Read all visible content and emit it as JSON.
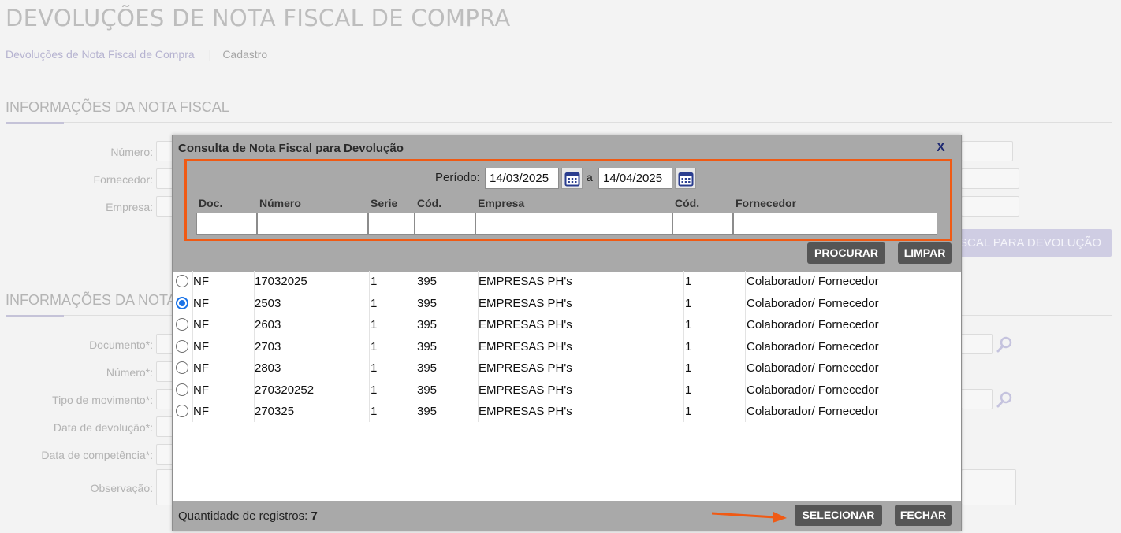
{
  "page": {
    "title": "DEVOLUÇÕES DE NOTA FISCAL DE COMPRA",
    "breadcrumb": [
      "Devoluções de Nota Fiscal de Compra",
      "Cadastro"
    ]
  },
  "section1": {
    "title": "INFORMAÇÕES DA NOTA FISCAL",
    "fields": {
      "numero": "Número:",
      "fornecedor": "Fornecedor:",
      "empresa": "Empresa:"
    },
    "button_partial": "SCAL PARA DEVOLUÇÃO"
  },
  "section2": {
    "title": "INFORMAÇÕES DA NOTA",
    "fields": {
      "documento": "Documento*:",
      "numero": "Número*:",
      "tipo_movimento": "Tipo de movimento*:",
      "data_devolucao": "Data de devolução*:",
      "data_competencia": "Data de competência*:",
      "observacao": "Observação:"
    }
  },
  "modal": {
    "title": "Consulta de Nota Fiscal para Devolução",
    "close_label": "X",
    "period_label": "Período:",
    "date_from": "14/03/2025",
    "date_sep": "a",
    "date_to": "14/04/2025",
    "columns": {
      "doc": "Doc.",
      "numero": "Número",
      "serie": "Serie",
      "cod_empresa": "Cód.",
      "empresa": "Empresa",
      "cod_fornecedor": "Cód.",
      "fornecedor": "Fornecedor"
    },
    "search_button": "PROCURAR",
    "clear_button": "LIMPAR",
    "rows": [
      {
        "doc": "NF",
        "numero": "17032025",
        "serie": "1",
        "cod_empresa": "395",
        "empresa": "EMPRESAS PH's",
        "cod_fornecedor": "1",
        "fornecedor": "Colaborador/ Fornecedor"
      },
      {
        "doc": "NF",
        "numero": "2503",
        "serie": "1",
        "cod_empresa": "395",
        "empresa": "EMPRESAS PH's",
        "cod_fornecedor": "1",
        "fornecedor": "Colaborador/ Fornecedor"
      },
      {
        "doc": "NF",
        "numero": "2603",
        "serie": "1",
        "cod_empresa": "395",
        "empresa": "EMPRESAS PH's",
        "cod_fornecedor": "1",
        "fornecedor": "Colaborador/ Fornecedor"
      },
      {
        "doc": "NF",
        "numero": "2703",
        "serie": "1",
        "cod_empresa": "395",
        "empresa": "EMPRESAS PH's",
        "cod_fornecedor": "1",
        "fornecedor": "Colaborador/ Fornecedor"
      },
      {
        "doc": "NF",
        "numero": "2803",
        "serie": "1",
        "cod_empresa": "395",
        "empresa": "EMPRESAS PH's",
        "cod_fornecedor": "1",
        "fornecedor": "Colaborador/ Fornecedor"
      },
      {
        "doc": "NF",
        "numero": "270320252",
        "serie": "1",
        "cod_empresa": "395",
        "empresa": "EMPRESAS PH's",
        "cod_fornecedor": "1",
        "fornecedor": "Colaborador/ Fornecedor"
      },
      {
        "doc": "NF",
        "numero": "270325",
        "serie": "1",
        "cod_empresa": "395",
        "empresa": "EMPRESAS PH's",
        "cod_fornecedor": "1",
        "fornecedor": "Colaborador/ Fornecedor"
      }
    ],
    "selected_row": 1,
    "count_label": "Quantidade de registros:",
    "count_value": "7",
    "select_button": "SELECIONAR",
    "close_button": "FECHAR"
  },
  "colors": {
    "highlight": "#f05a14",
    "button_dark": "#555555",
    "modal_bar": "#a9a9a9",
    "radio_selected": "#1a73e8"
  }
}
